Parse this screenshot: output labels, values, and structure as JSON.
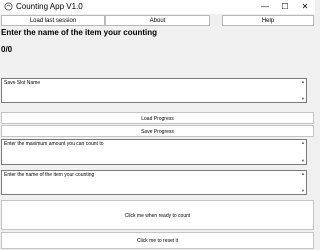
{
  "window": {
    "title": "Counting App V1.0",
    "controls": {
      "minimize": "—",
      "maximize": "☐",
      "close": "✕"
    }
  },
  "menu": {
    "load_last_session": "Load last session",
    "about": "About",
    "help": "Help"
  },
  "main": {
    "heading": "Enter the name of the item your counting",
    "count": "0/0",
    "save_slot_placeholder": "Save Slot Name",
    "load_progress": "Load Progress",
    "save_progress": "Save Progress",
    "max_amount_placeholder": "Enter the maximum amount you can count to",
    "item_name_placeholder": "Enter the name of the item your counting",
    "ready_button": "Click me when ready to count",
    "reset_button": "Click me to reset it"
  },
  "icons": {
    "app": "counter-app-icon",
    "scroll_up": "scroll-up-arrow-icon",
    "scroll_down": "scroll-down-arrow-icon"
  }
}
